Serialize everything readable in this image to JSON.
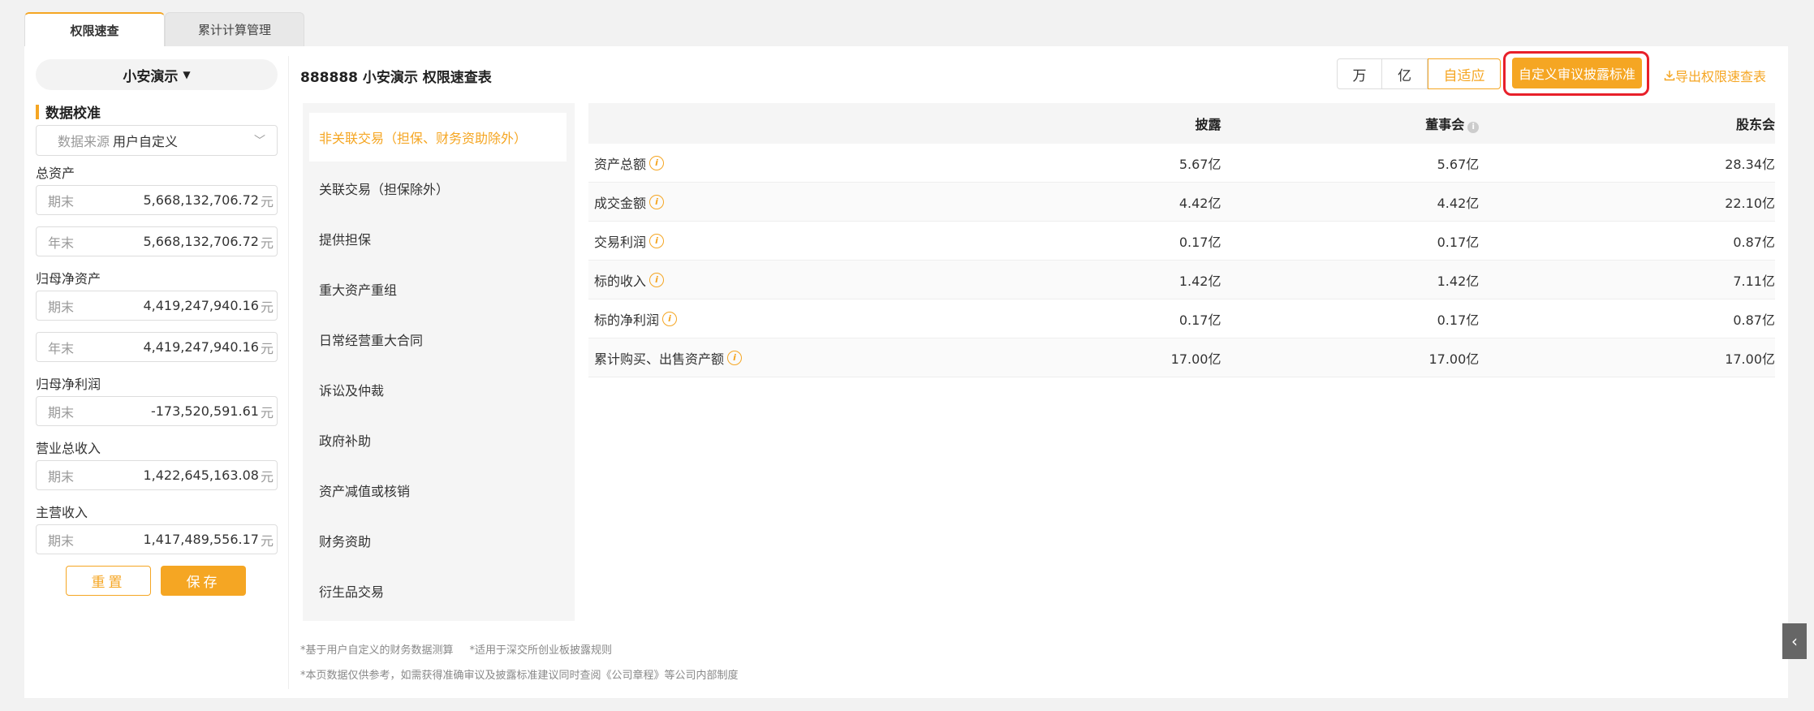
{
  "tabs": [
    "权限速查",
    "累计计算管理"
  ],
  "sidebar": {
    "company": "小安演示",
    "section_title": "数据校准",
    "source_label": "数据来源",
    "source_value": "用户自定义",
    "groups": [
      {
        "label": "总资产",
        "fields": [
          {
            "label": "期末",
            "value": "5,668,132,706.72",
            "unit": "元"
          },
          {
            "label": "年末",
            "value": "5,668,132,706.72",
            "unit": "元"
          }
        ]
      },
      {
        "label": "归母净资产",
        "fields": [
          {
            "label": "期末",
            "value": "4,419,247,940.16",
            "unit": "元"
          },
          {
            "label": "年末",
            "value": "4,419,247,940.16",
            "unit": "元"
          }
        ]
      },
      {
        "label": "归母净利润",
        "fields": [
          {
            "label": "期末",
            "value": "-173,520,591.61",
            "unit": "元"
          }
        ]
      },
      {
        "label": "营业总收入",
        "fields": [
          {
            "label": "期末",
            "value": "1,422,645,163.08",
            "unit": "元"
          }
        ]
      },
      {
        "label": "主营收入",
        "fields": [
          {
            "label": "期末",
            "value": "1,417,489,556.17",
            "unit": "元"
          }
        ]
      }
    ],
    "reset_label": "重置",
    "save_label": "保存"
  },
  "main": {
    "title": "888888 小安演示 权限速查表",
    "units": [
      "万",
      "亿",
      "自适应"
    ],
    "custom_button": "自定义审议披露标准",
    "export_link": "导出权限速查表",
    "categories": [
      "非关联交易（担保、财务资助除外）",
      "关联交易（担保除外）",
      "提供担保",
      "重大资产重组",
      "日常经营重大合同",
      "诉讼及仲裁",
      "政府补助",
      "资产减值或核销",
      "财务资助",
      "衍生品交易"
    ],
    "table": {
      "headers": [
        "",
        "披露",
        "董事会",
        "股东会"
      ],
      "rows": [
        [
          "资产总额",
          "5.67亿",
          "5.67亿",
          "28.34亿"
        ],
        [
          "成交金额",
          "4.42亿",
          "4.42亿",
          "22.10亿"
        ],
        [
          "交易利润",
          "0.17亿",
          "0.17亿",
          "0.87亿"
        ],
        [
          "标的收入",
          "1.42亿",
          "1.42亿",
          "7.11亿"
        ],
        [
          "标的净利润",
          "0.17亿",
          "0.17亿",
          "0.87亿"
        ],
        [
          "累计购买、出售资产额",
          "17.00亿",
          "17.00亿",
          "17.00亿"
        ]
      ]
    },
    "footnotes": [
      "*基于用户自定义的财务数据测算",
      "*适用于深交所创业板披露规则",
      "*本页数据仅供参考，如需获得准确审议及披露标准建议同时查阅《公司章程》等公司内部制度"
    ]
  },
  "colors": {
    "accent": "#f5a623",
    "highlight": "#e8202a"
  }
}
